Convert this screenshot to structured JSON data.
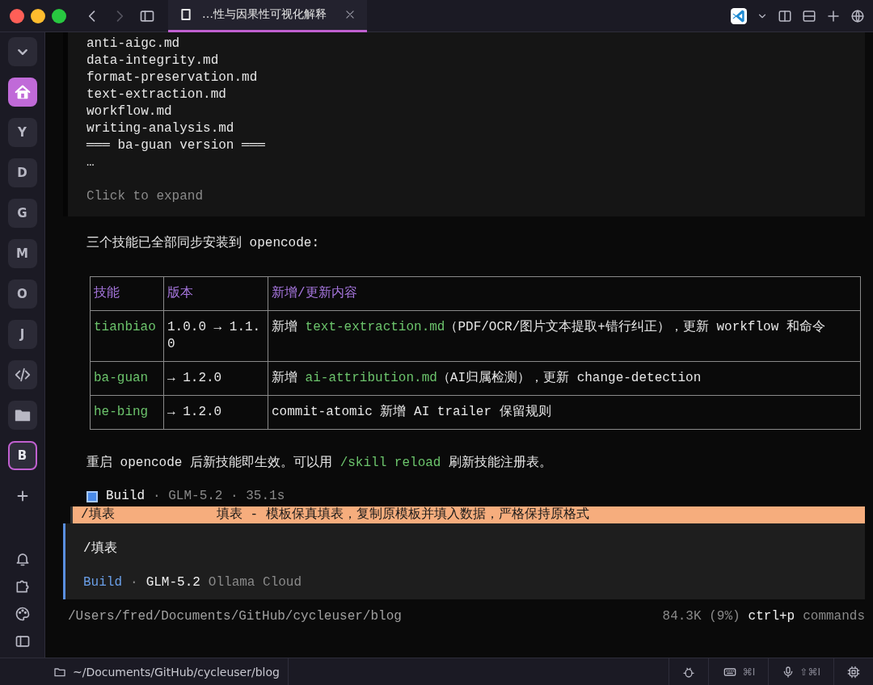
{
  "tab": {
    "title": "…性与因果性可视化解释",
    "selected": true
  },
  "sidebar": {
    "items": [
      {
        "kind": "collapse",
        "selected": false
      },
      {
        "kind": "home",
        "selected": true
      },
      {
        "kind": "letter",
        "label": "Y",
        "selected": false
      },
      {
        "kind": "letter",
        "label": "D",
        "selected": false
      },
      {
        "kind": "letter",
        "label": "G",
        "selected": false
      },
      {
        "kind": "letter",
        "label": "M",
        "selected": false
      },
      {
        "kind": "letter",
        "label": "O",
        "selected": false
      },
      {
        "kind": "letter",
        "label": "J",
        "selected": false
      },
      {
        "kind": "code",
        "selected": false
      },
      {
        "kind": "folder",
        "selected": false
      },
      {
        "kind": "letter",
        "label": "B",
        "selected": true
      },
      {
        "kind": "add",
        "selected": false
      }
    ]
  },
  "output_block": {
    "lines": [
      "anti-aigc.md",
      "data-integrity.md",
      "format-preservation.md",
      "text-extraction.md",
      "workflow.md",
      "writing-analysis.md",
      "═══ ba-guan version ═══",
      "…"
    ],
    "hint": "Click to expand"
  },
  "intro": "三个技能已全部同步安装到 opencode:",
  "table": {
    "columns": [
      "技能",
      "版本",
      "新增/更新内容"
    ],
    "rows": [
      [
        [
          {
            "kind": "code",
            "text": "tianbiao"
          }
        ],
        [
          {
            "kind": "plain",
            "text": "1.0.0 → 1.1.0"
          }
        ],
        [
          {
            "kind": "plain",
            "text": "新增 "
          },
          {
            "kind": "code",
            "text": "text-extraction.md"
          },
          {
            "kind": "plain",
            "text": "（PDF/OCR/图片文本提取+错行纠正），更新 workflow 和命令"
          }
        ]
      ],
      [
        [
          {
            "kind": "code",
            "text": "ba-guan"
          }
        ],
        [
          {
            "kind": "plain",
            "text": "→ 1.2.0"
          }
        ],
        [
          {
            "kind": "plain",
            "text": "新增 "
          },
          {
            "kind": "code",
            "text": "ai-attribution.md"
          },
          {
            "kind": "plain",
            "text": "（AI归属检测），更新 change-detection"
          }
        ]
      ],
      [
        [
          {
            "kind": "code",
            "text": "he-bing"
          }
        ],
        [
          {
            "kind": "plain",
            "text": "→ 1.2.0"
          }
        ],
        [
          {
            "kind": "plain",
            "text": "commit-atomic 新增 AI trailer 保留规则"
          }
        ]
      ]
    ]
  },
  "closing": [
    {
      "kind": "plain",
      "text": "重启 opencode 后新技能即生效。可以用 "
    },
    {
      "kind": "code",
      "text": "/skill reload"
    },
    {
      "kind": "plain",
      "text": " 刷新技能注册表。"
    }
  ],
  "build_status": {
    "agent": "Build",
    "details": "· GLM-5.2 · 35.1s"
  },
  "suggestions": [
    {
      "command": "/填表",
      "description": "填表 - 模板保真填表，复制原模板并填入数据，严格保持原格式",
      "selected": true
    }
  ],
  "prompt": {
    "value": "/填表",
    "agent": "Build",
    "separator": "·",
    "model": "GLM-5.2",
    "provider": "Ollama Cloud"
  },
  "footer": {
    "path": "/Users/fred/Documents/GitHub/cycleuser/blog",
    "usage": "84.3K (9%)",
    "shortcut": "ctrl+p",
    "shortcut_label": "commands"
  },
  "status_bar": {
    "path": "~/Documents/GitHub/cycleuser/blog",
    "keyboard_shortcut": "⌘I",
    "voice_shortcut": "⇧⌘I"
  }
}
